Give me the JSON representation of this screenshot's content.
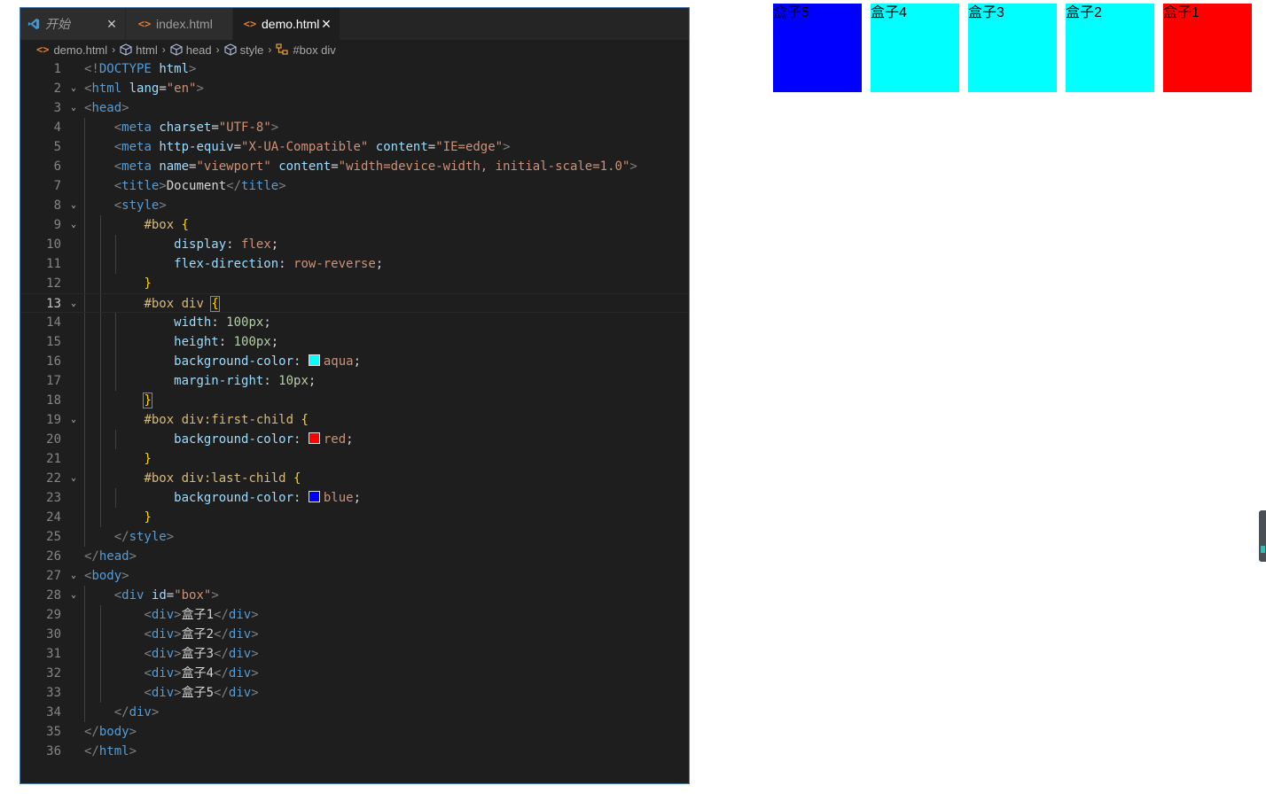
{
  "tabs": [
    {
      "label": "开始",
      "icon": "vscode-logo-icon",
      "closable": true,
      "active": false
    },
    {
      "label": "index.html",
      "icon": "html-file-icon",
      "closable": false,
      "active": false
    },
    {
      "label": "demo.html",
      "icon": "html-file-icon",
      "closable": true,
      "active": true
    }
  ],
  "close_glyph": "×",
  "breadcrumb": [
    {
      "label": "demo.html",
      "icon": "html-file-icon"
    },
    {
      "label": "html",
      "icon": "element-icon"
    },
    {
      "label": "head",
      "icon": "element-icon"
    },
    {
      "label": "style",
      "icon": "element-icon"
    },
    {
      "label": "#box div",
      "icon": "css-selector-icon"
    }
  ],
  "breadcrumb_separator": "›",
  "code": {
    "current_line": 13,
    "lines": [
      "<!DOCTYPE html>",
      "<html lang=\"en\">",
      "<head>",
      "    <meta charset=\"UTF-8\">",
      "    <meta http-equiv=\"X-UA-Compatible\" content=\"IE=edge\">",
      "    <meta name=\"viewport\" content=\"width=device-width, initial-scale=1.0\">",
      "    <title>Document</title>",
      "    <style>",
      "        #box {",
      "            display: flex;",
      "            flex-direction: row-reverse;",
      "        }",
      "        #box div {",
      "            width: 100px;",
      "            height: 100px;",
      "            background-color: aqua;",
      "            margin-right: 10px;",
      "        }",
      "        #box div:first-child {",
      "            background-color: red;",
      "        }",
      "        #box div:last-child {",
      "            background-color: blue;",
      "        }",
      "    </style>",
      "</head>",
      "<body>",
      "    <div id=\"box\">",
      "        <div>盒子1</div>",
      "        <div>盒子2</div>",
      "        <div>盒子3</div>",
      "        <div>盒子4</div>",
      "        <div>盒子5</div>",
      "    </div>",
      "</body>",
      "</html>"
    ],
    "foldable_lines": [
      2,
      3,
      8,
      9,
      13,
      19,
      22,
      27,
      28
    ],
    "swatches": {
      "aqua": "#00ffff",
      "red": "#ff0000",
      "blue": "#0000ff"
    }
  },
  "preview": {
    "boxes": [
      {
        "label": "盒子5",
        "color": "#0000ff"
      },
      {
        "label": "盒子4",
        "color": "#00ffff"
      },
      {
        "label": "盒子3",
        "color": "#00ffff"
      },
      {
        "label": "盒子2",
        "color": "#00ffff"
      },
      {
        "label": "盒子1",
        "color": "#ff0000"
      }
    ]
  },
  "colors": {
    "editor_bg": "#1e1e1e",
    "tab_bar_bg": "#252526",
    "keyword": "#569cd6",
    "attribute": "#9cdcfe",
    "string": "#ce9178",
    "number": "#b5cea8",
    "selector": "#d7ba7d",
    "bracket": "#ffd700"
  }
}
